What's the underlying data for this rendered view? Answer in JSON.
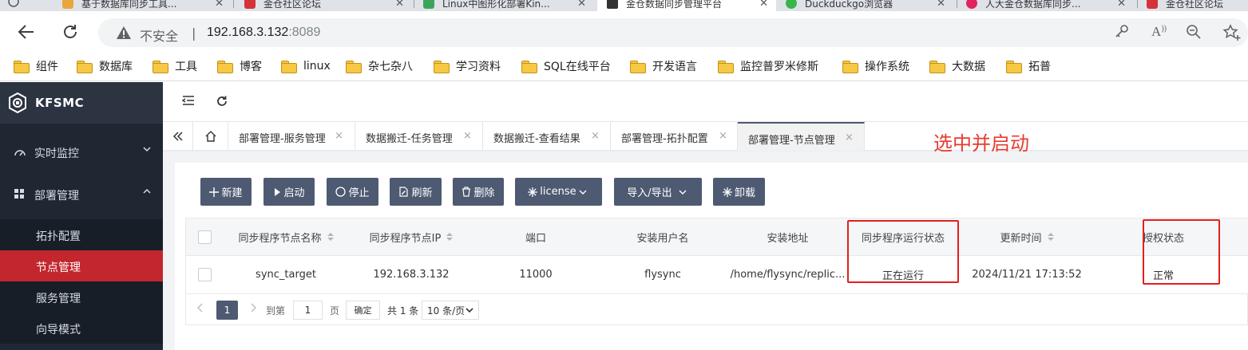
{
  "browser": {
    "tabs": [
      {
        "title": "基于数据库同步工具...",
        "fav_color": "#e9a63b"
      },
      {
        "title": "金仓社区论坛",
        "fav_color": "#d6323a"
      },
      {
        "title": "Linux中图形化部署Kin...",
        "fav_color": "#3ba55d"
      },
      {
        "title": "金仓数据同步管理平台",
        "fav_color": "#333333"
      },
      {
        "title": "Duckduckgo浏览器",
        "fav_color": "#3ab54a"
      },
      {
        "title": "人大金仓数据库同步...",
        "fav_color": "#e0245e"
      },
      {
        "title": "金仓社区论坛",
        "fav_color": "#d6323a"
      }
    ],
    "address": {
      "security_label": "不安全",
      "separator": "|",
      "host": "192.168.3.132",
      "port": ":8089"
    },
    "bookmarks": [
      "组件",
      "数据库",
      "工具",
      "博客",
      "linux",
      "杂七杂八",
      "学习资料",
      "SQL在线平台",
      "开发语言",
      "监控普罗米修斯",
      "操作系统",
      "大数据",
      "拓普"
    ]
  },
  "app": {
    "brand": "KFSMC",
    "menu": {
      "group1": "实时监控",
      "group2": "部署管理",
      "sub": [
        "拓扑配置",
        "节点管理",
        "服务管理",
        "向导模式"
      ]
    },
    "tabs": [
      "部署管理-服务管理",
      "数据搬迁-任务管理",
      "数据搬迁-查看结果",
      "部署管理-拓扑配置",
      "部署管理-节点管理"
    ],
    "close_glyph": "×",
    "annotation": "选中并启动",
    "buttons": {
      "new": "新建",
      "start": "启动",
      "stop": "停止",
      "refresh": "刷新",
      "delete": "删除",
      "license": "license",
      "import_export": "导入/导出",
      "uninstall": "卸载"
    },
    "table": {
      "headers": [
        "同步程序节点名称",
        "同步程序节点IP",
        "端口",
        "安装用户名",
        "安装地址",
        "同步程序运行状态",
        "更新时间",
        "授权状态"
      ],
      "rows": [
        [
          "sync_target",
          "192.168.3.132",
          "11000",
          "flysync",
          "/home/flysync/replic...",
          "正在运行",
          "2024/11/21 17:13:52",
          "正常"
        ]
      ]
    },
    "pager": {
      "current": "1",
      "goto_label": "到第",
      "goto_value": "1",
      "page_label": "页",
      "confirm": "确定",
      "total": "共 1 条",
      "size": "10 条/页"
    }
  }
}
